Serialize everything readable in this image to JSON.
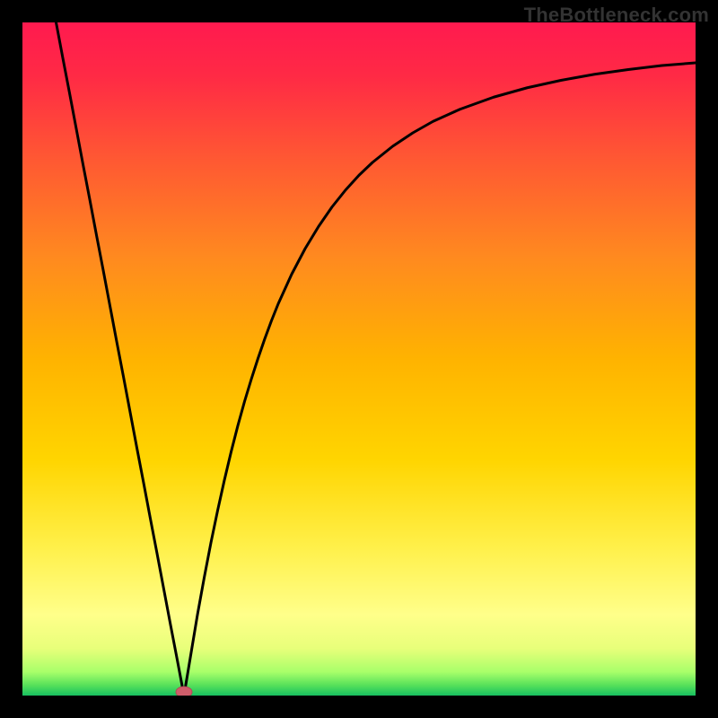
{
  "watermark": "TheBottleneck.com",
  "colors": {
    "frame": "#000000",
    "curve": "#000000",
    "marker_fill": "#cf5d6a",
    "marker_stroke": "#b24a56",
    "gradient_stops": [
      {
        "offset": 0.0,
        "color": "#ff1a4f"
      },
      {
        "offset": 0.08,
        "color": "#ff2a45"
      },
      {
        "offset": 0.2,
        "color": "#ff5733"
      },
      {
        "offset": 0.35,
        "color": "#ff8a1f"
      },
      {
        "offset": 0.5,
        "color": "#ffb300"
      },
      {
        "offset": 0.65,
        "color": "#ffd500"
      },
      {
        "offset": 0.78,
        "color": "#fff04a"
      },
      {
        "offset": 0.88,
        "color": "#ffff8a"
      },
      {
        "offset": 0.93,
        "color": "#e8ff7a"
      },
      {
        "offset": 0.965,
        "color": "#a8ff6a"
      },
      {
        "offset": 0.985,
        "color": "#55e05a"
      },
      {
        "offset": 1.0,
        "color": "#18c060"
      }
    ]
  },
  "chart_data": {
    "type": "line",
    "title": "",
    "xlabel": "",
    "ylabel": "",
    "xlim": [
      0,
      100
    ],
    "ylim": [
      0,
      100
    ],
    "grid": false,
    "legend": false,
    "annotations": [],
    "minimum_marker": {
      "x": 24,
      "y": 0
    },
    "x": [
      5,
      6,
      7,
      8,
      9,
      10,
      11,
      12,
      13,
      14,
      15,
      16,
      17,
      18,
      19,
      20,
      21,
      22,
      23,
      24,
      25,
      26,
      27,
      28,
      29,
      30,
      31,
      32,
      33,
      34,
      35,
      36,
      37,
      38,
      40,
      42,
      44,
      46,
      48,
      50,
      52,
      55,
      58,
      61,
      65,
      70,
      75,
      80,
      85,
      90,
      95,
      100
    ],
    "y": [
      100,
      94.7,
      89.5,
      84.2,
      78.9,
      73.7,
      68.4,
      63.2,
      57.9,
      52.6,
      47.4,
      42.1,
      36.8,
      31.6,
      26.3,
      21.1,
      15.8,
      10.5,
      5.3,
      0,
      6,
      12,
      17.5,
      22.7,
      27.5,
      32,
      36.2,
      40.1,
      43.7,
      47,
      50.1,
      53,
      55.7,
      58.2,
      62.6,
      66.4,
      69.7,
      72.6,
      75.1,
      77.3,
      79.2,
      81.6,
      83.6,
      85.3,
      87.1,
      88.9,
      90.3,
      91.4,
      92.3,
      93,
      93.6,
      94
    ]
  }
}
